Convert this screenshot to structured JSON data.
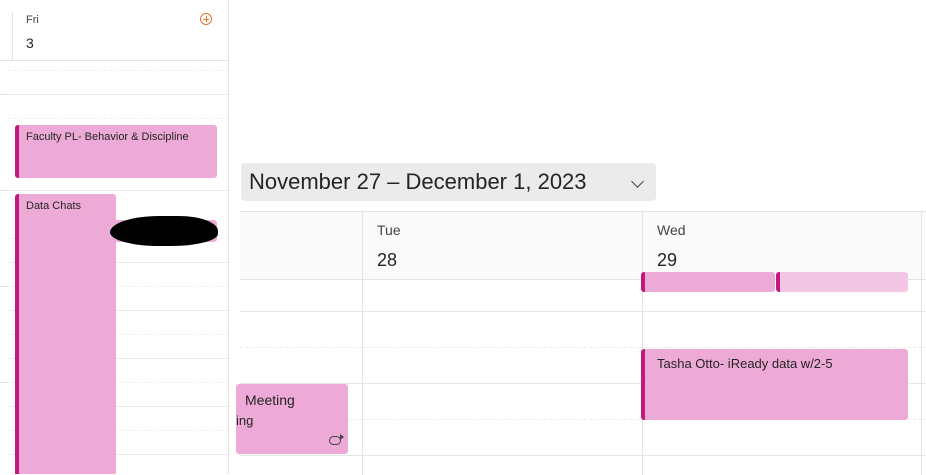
{
  "day_column": {
    "day_name": "Fri",
    "day_number": "3",
    "events": [
      {
        "title": "Faculty PL- Behavior & Discipline"
      },
      {
        "title": "Data Chats"
      }
    ]
  },
  "week_view": {
    "title": "November 27 – December 1, 2023",
    "days": [
      {
        "name": "Tue",
        "number": "28"
      },
      {
        "name": "Wed",
        "number": "29"
      }
    ],
    "events": [
      {
        "title": "Meeting",
        "subtitle": "ing",
        "recurring": true
      },
      {
        "title": "Tasha Otto- iReady data w/2-5"
      }
    ]
  },
  "colors": {
    "event_fill": "#eeaad6",
    "event_accent": "#c2187f",
    "add_icon": "#e8742e"
  }
}
